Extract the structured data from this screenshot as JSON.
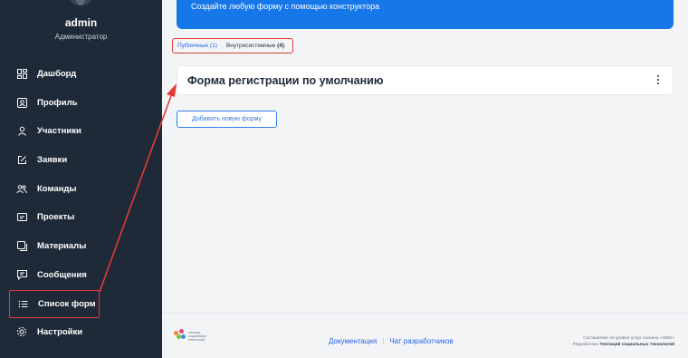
{
  "user": {
    "name": "admin",
    "role": "Администратор"
  },
  "nav": [
    {
      "label": "Дашборд",
      "icon": "dashboard-icon"
    },
    {
      "label": "Профиль",
      "icon": "profile-icon"
    },
    {
      "label": "Участники",
      "icon": "user-icon"
    },
    {
      "label": "Заявки",
      "icon": "edit-icon"
    },
    {
      "label": "Команды",
      "icon": "team-icon"
    },
    {
      "label": "Проекты",
      "icon": "project-icon"
    },
    {
      "label": "Материалы",
      "icon": "materials-icon"
    },
    {
      "label": "Сообщения",
      "icon": "message-icon"
    },
    {
      "label": "Список форм",
      "icon": "list-icon"
    },
    {
      "label": "Настройки",
      "icon": "gear-icon"
    }
  ],
  "banner": {
    "text": "Создайте любую форму с помощью конструктора"
  },
  "tabs": [
    {
      "label": "Публичные",
      "count": "(1)"
    },
    {
      "label": "Внутрисистемные",
      "count": "(4)"
    }
  ],
  "form": {
    "title": "Форма регистрации по умолчанию"
  },
  "add_button": {
    "label": "Добавить новую форму"
  },
  "footer": {
    "logo_text": "теплица социальных технологий",
    "link_docs": "Документация",
    "link_chat": "Чат разработчиков",
    "legal_line1": "Соглашение об уровне услуг плагина «HMS»",
    "legal_line2_prefix": "Разработано",
    "legal_line2_org": "Теплицей социальных технологий"
  },
  "colors": {
    "sidebar_bg": "#1e2a38",
    "accent_blue": "#1677e8",
    "highlight_red": "#e23b3b",
    "page_bg": "#f3f4f6"
  }
}
